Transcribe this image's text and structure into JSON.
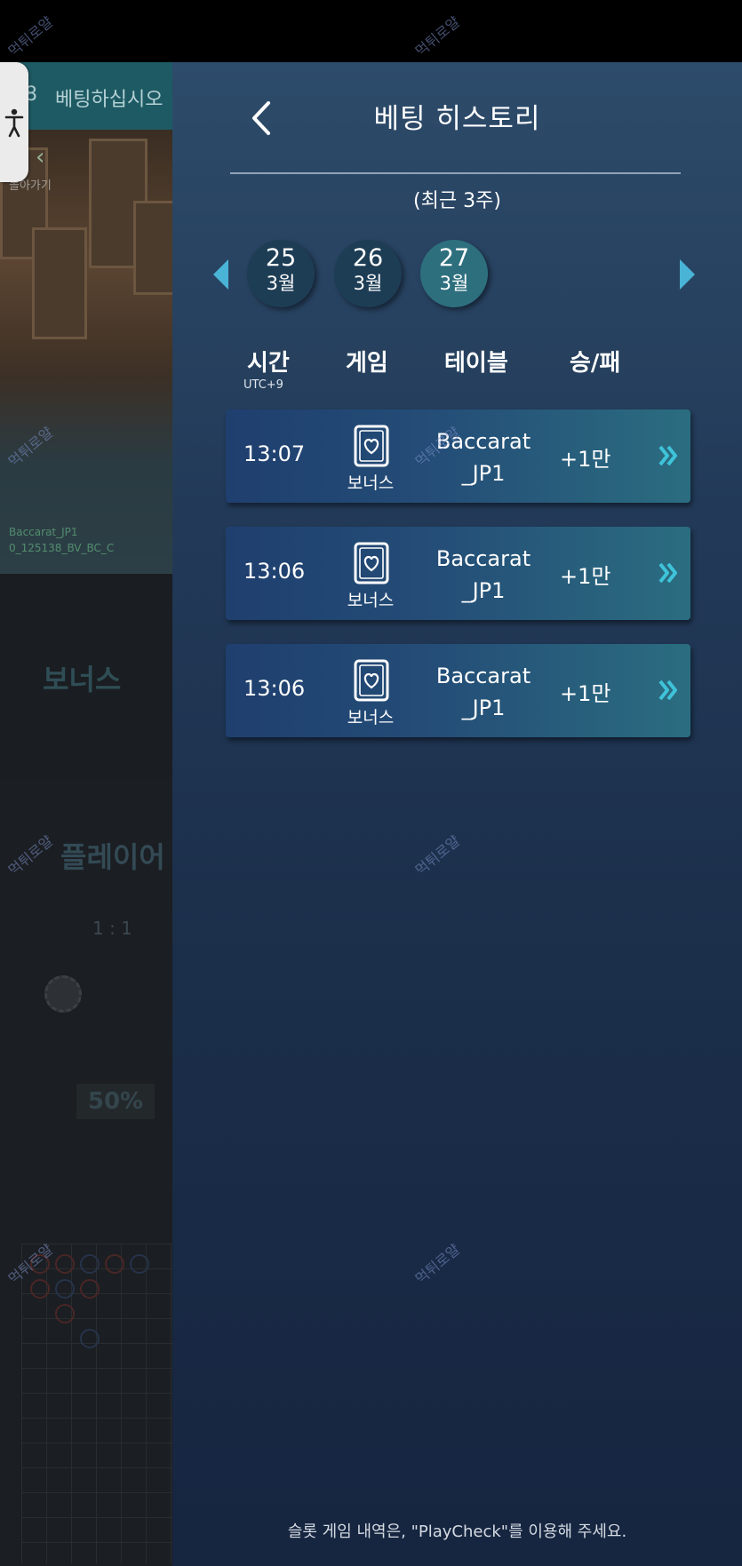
{
  "background": {
    "header_title": "베팅하십시오",
    "header_num": "8",
    "back_label": "돌아가기",
    "caption_line1": "Baccarat_JP1",
    "caption_line2": "0_125138_BV_BC_C",
    "bonus_label": "보너스",
    "player_label": "플레이어",
    "ratio": "1 : 1",
    "percent": "50%"
  },
  "panel": {
    "title": "베팅 히스토리",
    "subtitle": "(최근 3주)",
    "dates": [
      {
        "day": "25",
        "month": "3월",
        "active": false
      },
      {
        "day": "26",
        "month": "3월",
        "active": false
      },
      {
        "day": "27",
        "month": "3월",
        "active": true
      }
    ],
    "columns": {
      "time": "시간",
      "time_sub": "UTC+9",
      "game": "게임",
      "table": "테이블",
      "result": "승/패"
    },
    "rows": [
      {
        "time": "13:07",
        "game": "보너스",
        "table_l1": "Baccarat",
        "table_l2": "_JP1",
        "result": "+1만"
      },
      {
        "time": "13:06",
        "game": "보너스",
        "table_l1": "Baccarat",
        "table_l2": "_JP1",
        "result": "+1만"
      },
      {
        "time": "13:06",
        "game": "보너스",
        "table_l1": "Baccarat",
        "table_l2": "_JP1",
        "result": "+1만"
      }
    ],
    "footer": "슬롯 게임 내역은, \"PlayCheck\"를 이용해 주세요."
  },
  "icons": {
    "back": "chevron-left-icon",
    "prev": "triangle-left-icon",
    "next": "triangle-right-icon",
    "game": "card-heart-icon",
    "row_more": "double-chevron-right-icon",
    "accessibility": "accessibility-icon"
  },
  "colors": {
    "accent": "#3fc3d9",
    "active_date": "#2e6f7e",
    "date": "#1d3d55",
    "panel_top": "#2d4b6a",
    "panel_bottom": "#162540"
  },
  "watermark": "먹튀로얄"
}
